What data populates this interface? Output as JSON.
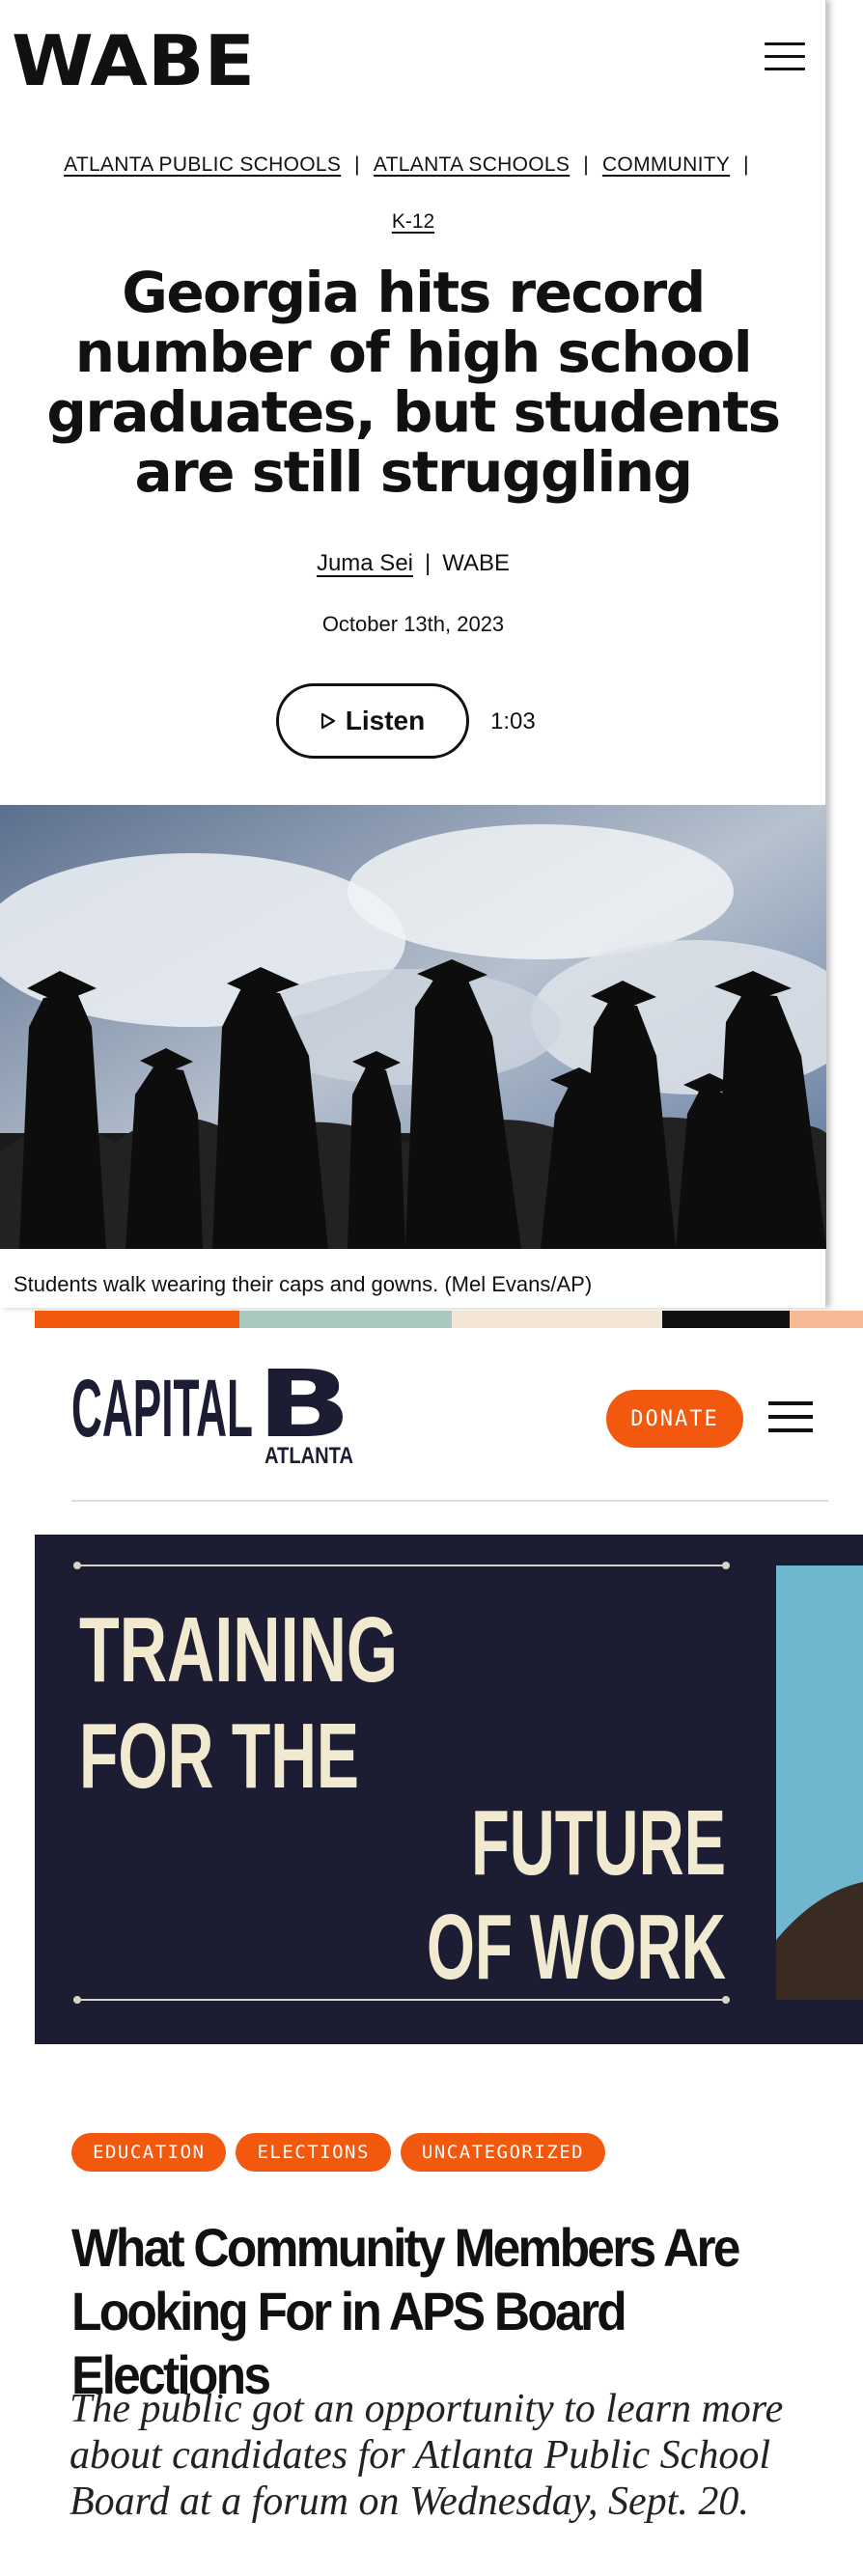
{
  "wabe": {
    "logo_text": "WABE",
    "breadcrumbs": [
      "ATLANTA PUBLIC SCHOOLS",
      "ATLANTA SCHOOLS",
      "COMMUNITY"
    ],
    "breadcrumb_separator": "|",
    "breadcrumb_extra": "K-12",
    "headline": "Georgia hits record number of high school graduates, but students are still struggling",
    "author": "Juma Sei",
    "byline_separator": "|",
    "outlet": "WABE",
    "date": "October 13th, 2023",
    "listen_label": "Listen",
    "duration": "1:03",
    "hero_caption": "Students walk wearing their caps and gowns. (Mel Evans/AP)"
  },
  "colorbar": [
    "#f2590e",
    "#a9c8c0",
    "#f3e6d6",
    "#111111",
    "#f7b896"
  ],
  "capital_b": {
    "logo_text": "CAPITAL",
    "logo_letter": "B",
    "logo_city": "ATLANTA",
    "donate_label": "DONATE",
    "accent": "#f2590e",
    "banner_lines": [
      "TRAINING",
      "FOR THE",
      "FUTURE",
      "OF WORK"
    ],
    "tags": [
      "EDUCATION",
      "ELECTIONS",
      "UNCATEGORIZED"
    ],
    "title": "What Community Members Are Looking For in APS Board Elections",
    "dek": "The public got an opportunity to learn more about candidates for Atlanta Public School Board at a forum on Wednesday, Sept. 20."
  }
}
